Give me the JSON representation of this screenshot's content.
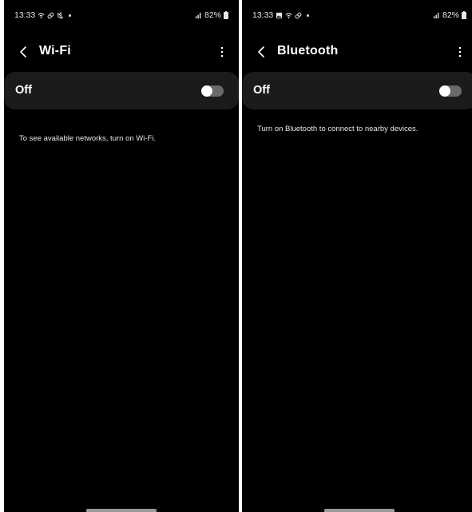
{
  "wifi_screen": {
    "status": {
      "time": "13:33",
      "battery": "82%"
    },
    "title": "Wi-Fi",
    "master_label": "Off",
    "toggle_on": false,
    "info": "To see available networks, turn on Wi-Fi."
  },
  "bluetooth_screen": {
    "status": {
      "time": "13:33",
      "battery": "82%"
    },
    "title": "Bluetooth",
    "master_label": "Off",
    "toggle_on": false,
    "info": "Turn on Bluetooth to connect to nearby devices."
  },
  "icons": {
    "back": "chevron-left-icon",
    "more": "more-vertical-icon",
    "signal": "signal-icon",
    "battery": "battery-icon"
  },
  "colors": {
    "background": "#000000",
    "row_background": "#1b1b1b",
    "toggle_track": "#6a6a6a",
    "toggle_knob": "#ffffff",
    "text": "#ffffff"
  }
}
